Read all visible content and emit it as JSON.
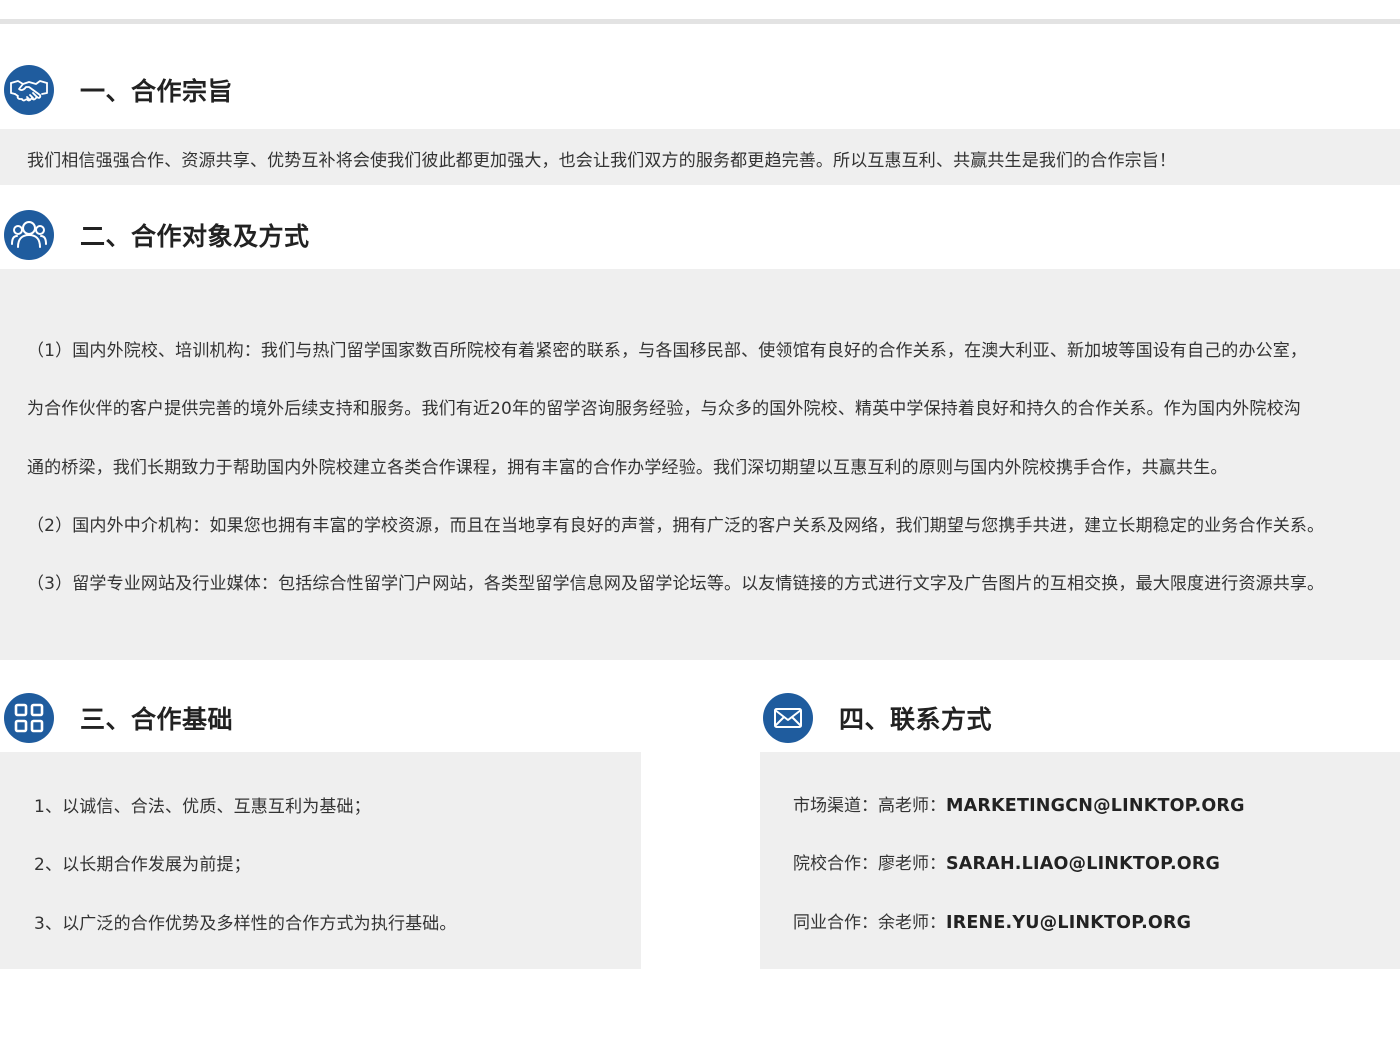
{
  "sections": {
    "s1": {
      "title": "一、合作宗旨",
      "icon": "handshake-icon",
      "lines": [
        "我们相信强强合作、资源共享、优势互补将会使我们彼此都更加强大，也会让我们双方的服务都更趋完善。所以互惠互利、共赢共生是我们的合作宗旨！"
      ]
    },
    "s2": {
      "title": "二、合作对象及方式",
      "icon": "users-icon",
      "lines": [
        "（1）国内外院校、培训机构：我们与热门留学国家数百所院校有着紧密的联系，与各国移民部、使领馆有良好的合作关系，在澳大利亚、新加坡等国设有自己的办公室，",
        "为合作伙伴的客户提供完善的境外后续支持和服务。我们有近20年的留学咨询服务经验，与众多的国外院校、精英中学保持着良好和持久的合作关系。作为国内外院校沟",
        "通的桥梁，我们长期致力于帮助国内外院校建立各类合作课程，拥有丰富的合作办学经验。我们深切期望以互惠互利的原则与国内外院校携手合作，共赢共生。",
        "（2）国内外中介机构：如果您也拥有丰富的学校资源，而且在当地享有良好的声誉，拥有广泛的客户关系及网络，我们期望与您携手共进，建立长期稳定的业务合作关系。",
        "（3）留学专业网站及行业媒体：包括综合性留学门户网站，各类型留学信息网及留学论坛等。以友情链接的方式进行文字及广告图片的互相交换，最大限度进行资源共享。"
      ]
    },
    "s3": {
      "title": "三、合作基础",
      "icon": "grid-icon",
      "lines": [
        "1、以诚信、合法、优质、互惠互利为基础；",
        "2、以长期合作发展为前提；",
        "3、以广泛的合作优势及多样性的合作方式为执行基础。"
      ]
    },
    "s4": {
      "title": "四、联系方式",
      "icon": "envelope-icon",
      "contacts": [
        {
          "label": "市场渠道：高老师：",
          "email": "MARKETINGCN@LINKTOP.ORG"
        },
        {
          "label": "院校合作：廖老师：",
          "email": "SARAH.LIAO@LINKTOP.ORG"
        },
        {
          "label": "同业合作：余老师：",
          "email": "IRENE.YU@LINKTOP.ORG"
        }
      ]
    }
  },
  "colors": {
    "accent": "#1f5c9e",
    "panel": "#efefef",
    "title": "#222222",
    "text": "#333333"
  }
}
